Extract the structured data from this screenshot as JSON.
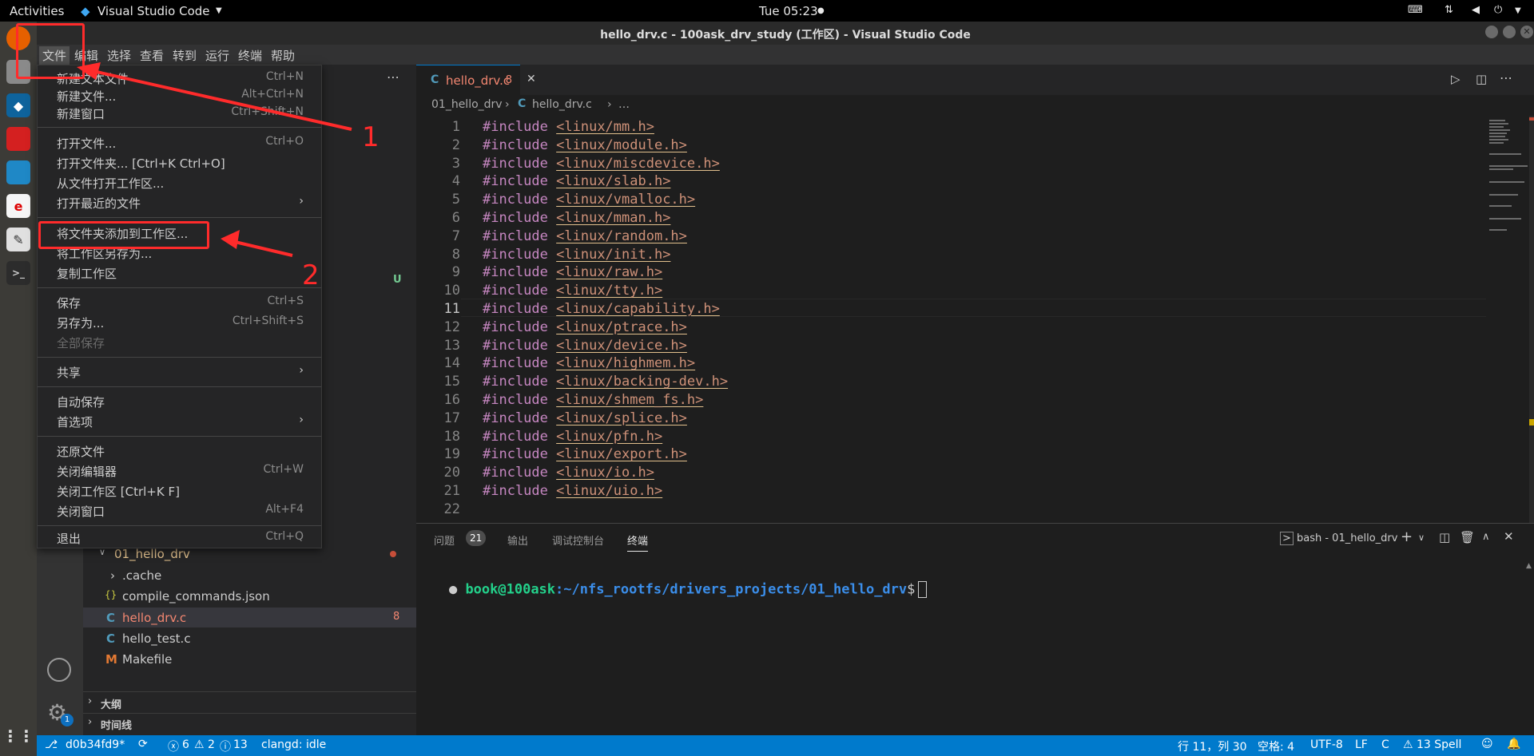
{
  "system": {
    "activities": "Activities",
    "app_menu": "Visual Studio Code",
    "clock": "Tue 05:23"
  },
  "window": {
    "title": "hello_drv.c - 100ask_drv_study (工作区) - Visual Studio Code"
  },
  "menubar": [
    "文件",
    "编辑",
    "选择",
    "查看",
    "转到",
    "运行",
    "终端",
    "帮助"
  ],
  "file_menu": [
    {
      "label": "新建文本文件",
      "key": "Ctrl+N"
    },
    {
      "label": "新建文件...",
      "key": "Alt+Ctrl+N"
    },
    {
      "label": "新建窗口",
      "key": "Ctrl+Shift+N"
    },
    {
      "label": "打开文件...",
      "key": "Ctrl+O"
    },
    {
      "label": "打开文件夹... [Ctrl+K Ctrl+O]",
      "key": ""
    },
    {
      "label": "从文件打开工作区...",
      "key": ""
    },
    {
      "label": "打开最近的文件",
      "key": ""
    },
    {
      "label": "将文件夹添加到工作区...",
      "key": ""
    },
    {
      "label": "将工作区另存为...",
      "key": ""
    },
    {
      "label": "复制工作区",
      "key": ""
    },
    {
      "label": "保存",
      "key": "Ctrl+S"
    },
    {
      "label": "另存为...",
      "key": "Ctrl+Shift+S"
    },
    {
      "label": "全部保存",
      "key": ""
    },
    {
      "label": "共享",
      "key": ""
    },
    {
      "label": "自动保存",
      "key": ""
    },
    {
      "label": "首选项",
      "key": ""
    },
    {
      "label": "还原文件",
      "key": ""
    },
    {
      "label": "关闭编辑器",
      "key": "Ctrl+W"
    },
    {
      "label": "关闭工作区 [Ctrl+K F]",
      "key": ""
    },
    {
      "label": "关闭窗口",
      "key": "Alt+F4"
    },
    {
      "label": "退出",
      "key": "Ctrl+Q"
    }
  ],
  "annotations": {
    "one": "1",
    "two": "2"
  },
  "explorer": {
    "git_badge": "U",
    "folder": "01_hello_drv",
    "files": [
      ".cache",
      "compile_commands.json",
      "hello_drv.c",
      "hello_test.c",
      "Makefile"
    ],
    "file_icons": [
      "›",
      "{}",
      "C",
      "C",
      "M"
    ],
    "active_badge": "8",
    "outline": "大纲",
    "timeline": "时间线"
  },
  "editor": {
    "tab_label": "hello_drv.c",
    "tab_badge": "8",
    "tab_icon": "C",
    "breadcrumb_folder": "01_hello_drv",
    "breadcrumb_file": "hello_drv.c",
    "breadcrumb_more": "…",
    "keyword": "#include",
    "lines": [
      "<linux/mm.h>",
      "<linux/module.h>",
      "<linux/miscdevice.h>",
      "<linux/slab.h>",
      "<linux/vmalloc.h>",
      "<linux/mman.h>",
      "<linux/random.h>",
      "<linux/init.h>",
      "<linux/raw.h>",
      "<linux/tty.h>",
      "<linux/capability.h>",
      "<linux/ptrace.h>",
      "<linux/device.h>",
      "<linux/highmem.h>",
      "<linux/backing-dev.h>",
      "<linux/shmem_fs.h>",
      "<linux/splice.h>",
      "<linux/pfn.h>",
      "<linux/export.h>",
      "<linux/io.h>",
      "<linux/uio.h>"
    ],
    "last_line_number": "22"
  },
  "panel": {
    "tabs": [
      "问题",
      "输出",
      "调试控制台",
      "终端"
    ],
    "problems_count": "21",
    "terminal_name": "bash - 01_hello_drv",
    "prompt_user": "book@100ask",
    "prompt_path": ":~/nfs_rootfs/drivers_projects/01_hello_drv",
    "prompt_symbol": "$"
  },
  "statusbar": {
    "branch": "d0b34fd9*",
    "errors": "6",
    "warnings": "2",
    "infos": "13",
    "lsp": "clangd: idle",
    "position": "行 11，列 30",
    "spaces": "空格: 4",
    "encoding": "UTF-8",
    "eol": "LF",
    "language": "C",
    "spell": "13 Spell",
    "notification_badge": "1"
  },
  "colors": {
    "accent": "#007acc",
    "annotation": "#ff2b2b"
  }
}
